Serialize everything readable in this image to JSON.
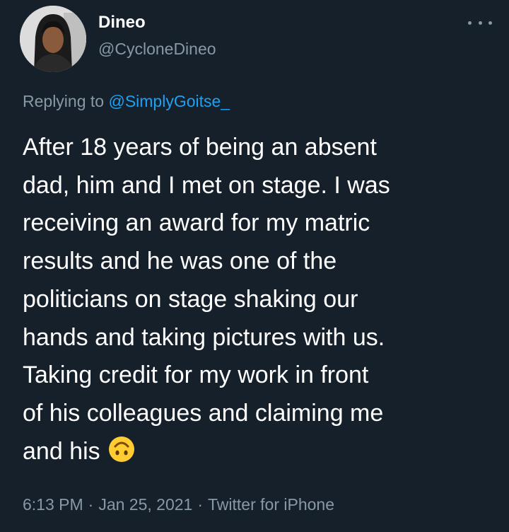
{
  "author": {
    "display_name": "Dineo",
    "handle": "@CycloneDineo",
    "avatar_icon": "profile-photo"
  },
  "menu": {
    "icon": "more-options-icon"
  },
  "reply": {
    "prefix": "Replying to",
    "mention": "@SimplyGoitse_"
  },
  "tweet": {
    "lines": [
      "After 18 years of being an absent",
      "dad, him and I met on stage. I was",
      "receiving an award for my matric",
      "results and he was one of the",
      "politicians on stage shaking our",
      "hands and taking pictures with us.",
      "Taking credit for my work in front",
      "of his colleagues and claiming me",
      "and his"
    ],
    "emoji": "upside-down-face-emoji"
  },
  "meta": {
    "time": "6:13 PM",
    "separator": "·",
    "date": "Jan 25, 2021",
    "source": "Twitter for iPhone"
  },
  "colors": {
    "background": "#15202b",
    "text_primary": "#ffffff",
    "text_secondary": "#8899a6",
    "link": "#1da1f2",
    "emoji": "#ffcc33"
  }
}
